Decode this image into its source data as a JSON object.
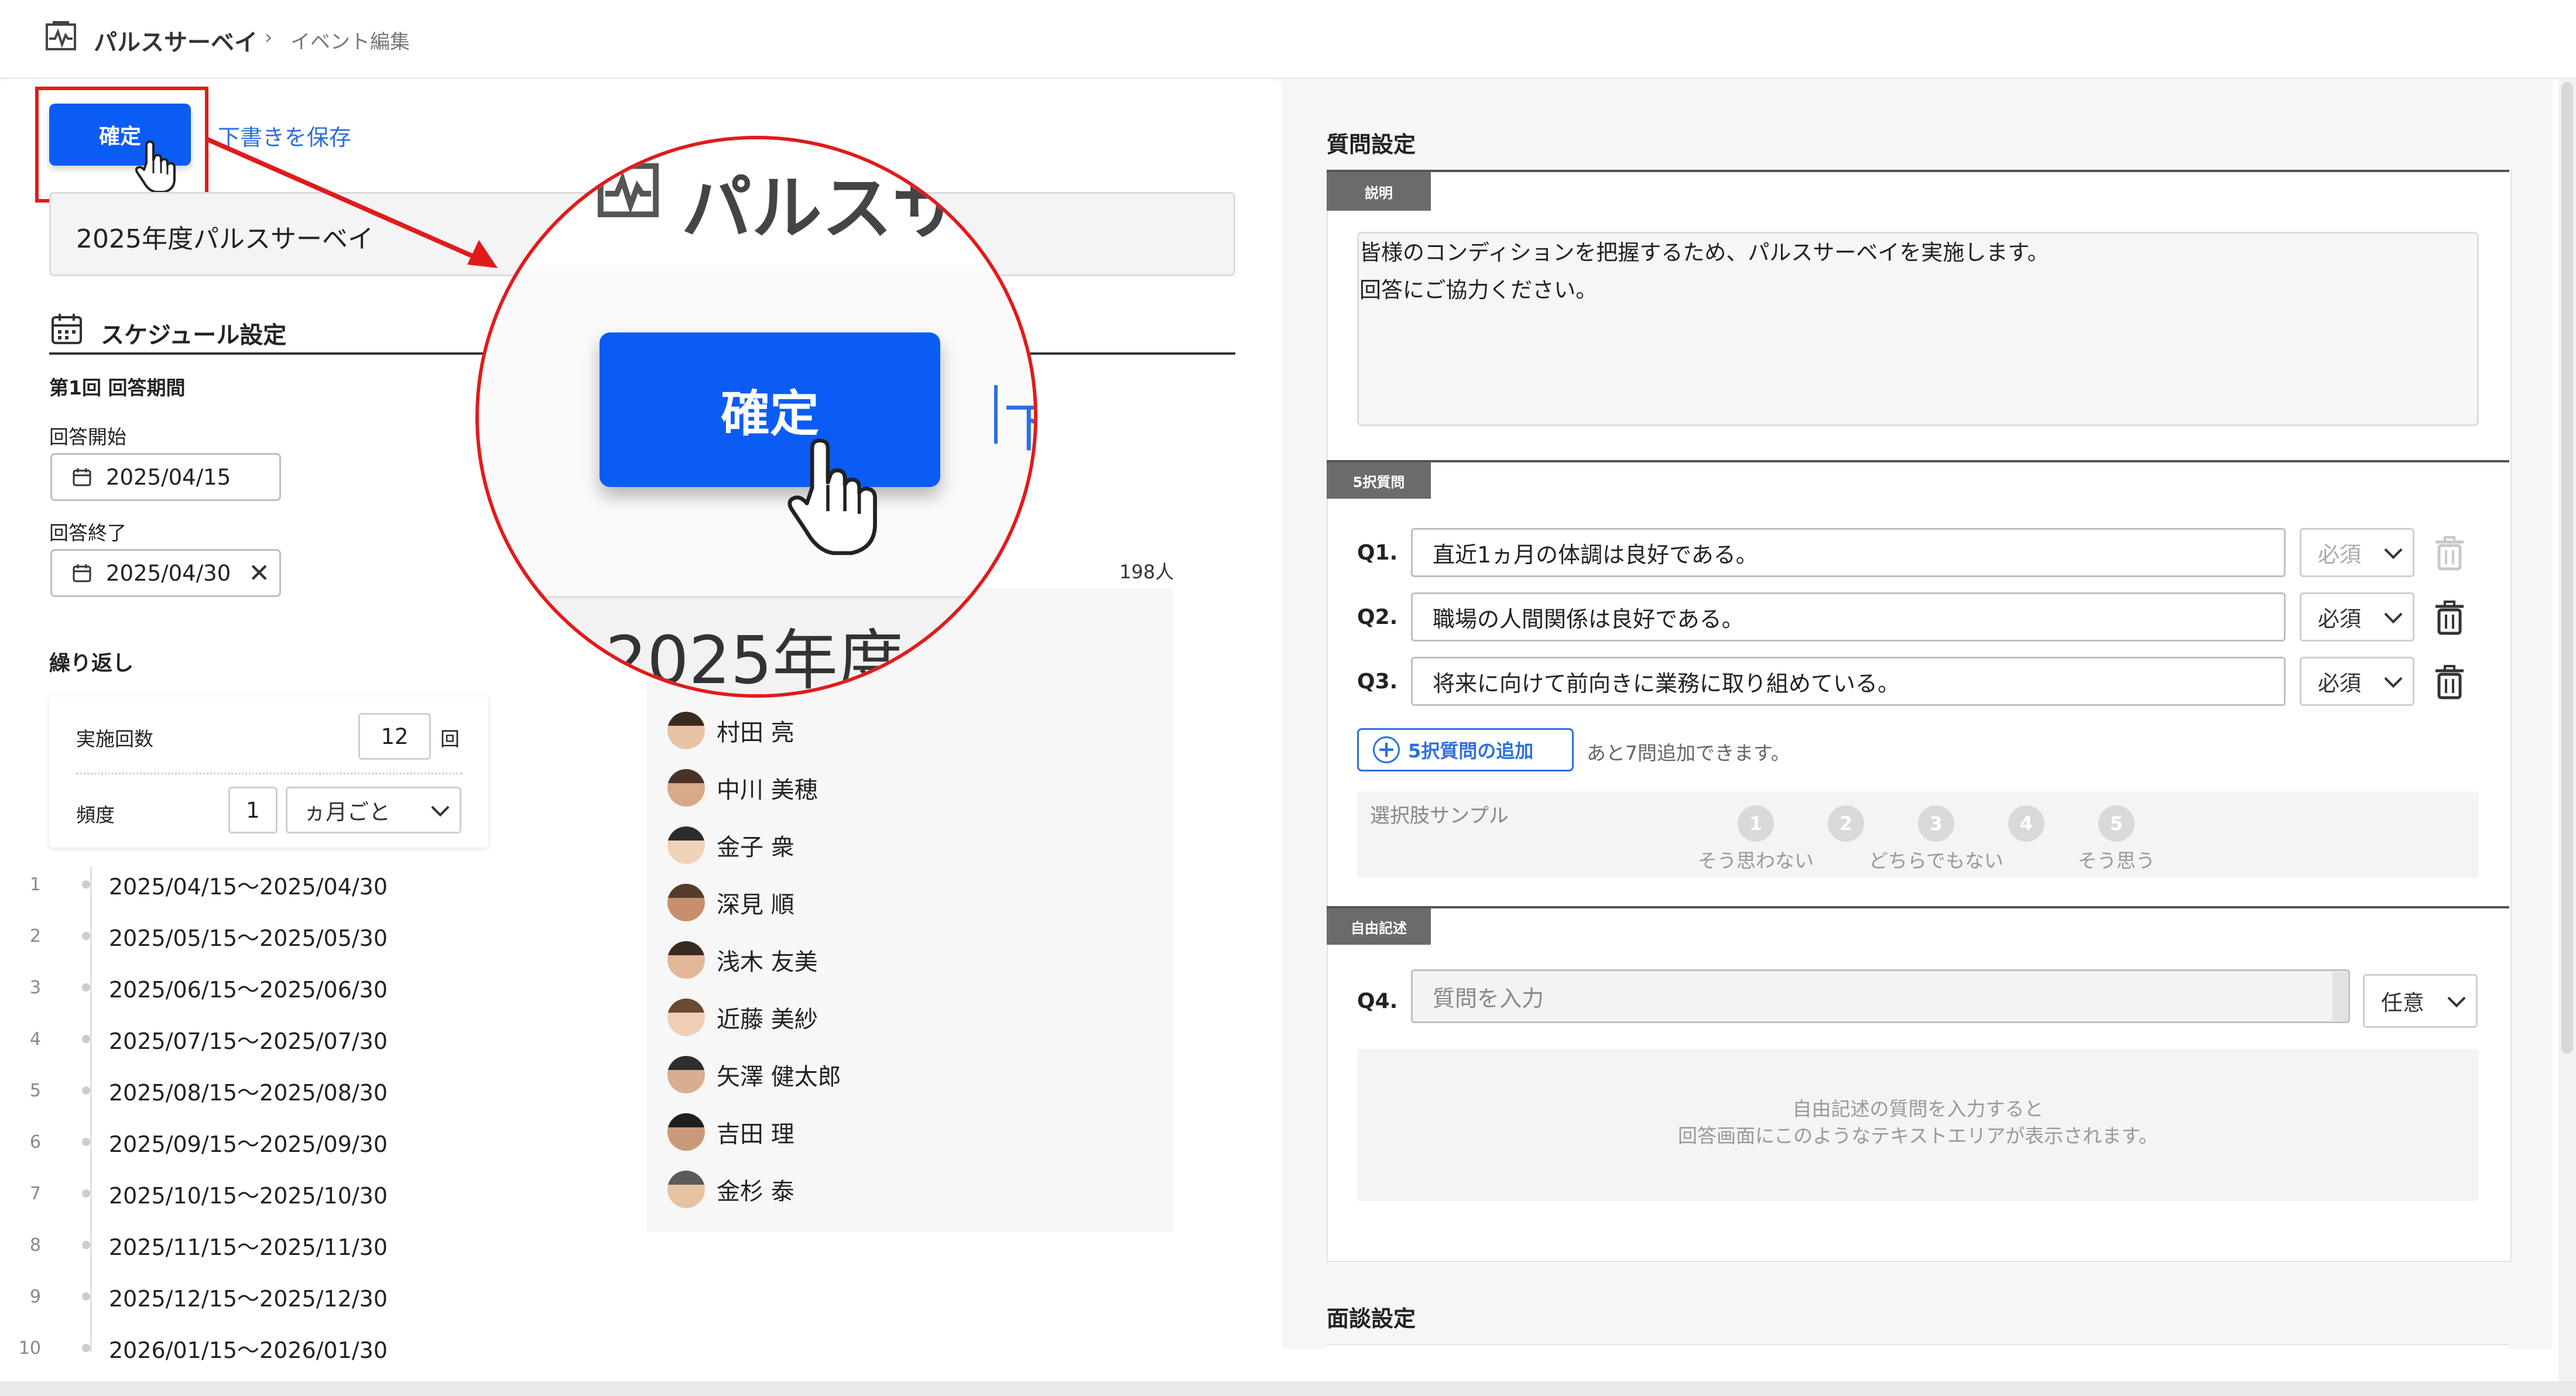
{
  "header": {
    "app_name": "パルスサーベイ",
    "separator": "›",
    "page": "イベント編集",
    "app_icon": "pulse-chart-icon"
  },
  "toolbar": {
    "confirm_label": "確定",
    "save_draft_label": "下書きを保存"
  },
  "event": {
    "title_value": "2025年度パルスサーベイ"
  },
  "schedule": {
    "section_title": "スケジュール設定",
    "period_title": "第1回 回答期間",
    "start_label": "回答開始",
    "start_value": "2025/04/15",
    "end_label": "回答終了",
    "end_value": "2025/04/30",
    "repeat_title": "繰り返し",
    "count_label": "実施回数",
    "count_value": "12",
    "count_unit": "回",
    "freq_label": "頻度",
    "freq_value": "1",
    "freq_unit": "ヵ月ごと",
    "rows": [
      {
        "n": "1",
        "range": "2025/04/15～2025/04/30"
      },
      {
        "n": "2",
        "range": "2025/05/15～2025/05/30"
      },
      {
        "n": "3",
        "range": "2025/06/15～2025/06/30"
      },
      {
        "n": "4",
        "range": "2025/07/15～2025/07/30"
      },
      {
        "n": "5",
        "range": "2025/08/15～2025/08/30"
      },
      {
        "n": "6",
        "range": "2025/09/15～2025/09/30"
      },
      {
        "n": "7",
        "range": "2025/10/15～2025/10/30"
      },
      {
        "n": "8",
        "range": "2025/11/15～2025/11/30"
      },
      {
        "n": "9",
        "range": "2025/12/15～2025/12/30"
      },
      {
        "n": "10",
        "range": "2026/01/15～2026/01/30"
      }
    ]
  },
  "targets": {
    "count": "198人",
    "people": [
      "村田 亮",
      "中川 美穂",
      "金子 衆",
      "深見 順",
      "浅木 友美",
      "近藤 美紗",
      "矢澤 健太郎",
      "吉田 理",
      "金杉 泰"
    ]
  },
  "zoom": {
    "app_name_partial": "パルスサ",
    "confirm_label": "確定",
    "partial_link": "下",
    "title_partial": "2025年度"
  },
  "questions": {
    "section_title": "質問設定",
    "desc_tag": "説明",
    "desc_line1": "皆様のコンディションを把握するため、パルスサーベイを実施します。",
    "desc_line2": "回答にご協力ください。",
    "five_tag": "5択質問",
    "items": [
      {
        "label": "Q1.",
        "text": "直近1ヵ月の体調は良好である。",
        "req": "必須"
      },
      {
        "label": "Q2.",
        "text": "職場の人間関係は良好である。",
        "req": "必須"
      },
      {
        "label": "Q3.",
        "text": "将来に向けて前向きに業務に取り組めている。",
        "req": "必須"
      }
    ],
    "add_label": "5択質問の追加",
    "remaining": "あと7問追加できます。",
    "sample_title": "選択肢サンプル",
    "choices": [
      {
        "num": "1",
        "label": "そう思わない"
      },
      {
        "num": "2",
        "label": ""
      },
      {
        "num": "3",
        "label": "どちらでもない"
      },
      {
        "num": "4",
        "label": ""
      },
      {
        "num": "5",
        "label": "そう思う"
      }
    ],
    "free_tag": "自由記述",
    "q4_label": "Q4.",
    "q4_placeholder": "質問を入力",
    "q4_req": "任意",
    "free_hint1": "自由記述の質問を入力すると",
    "free_hint2": "回答画面にこのようなテキストエリアが表示されます。"
  },
  "interview": {
    "section_title": "面談設定"
  },
  "colors": {
    "primary": "#0b5cf5",
    "highlight": "#e11b1b",
    "link": "#2c6fe0"
  }
}
